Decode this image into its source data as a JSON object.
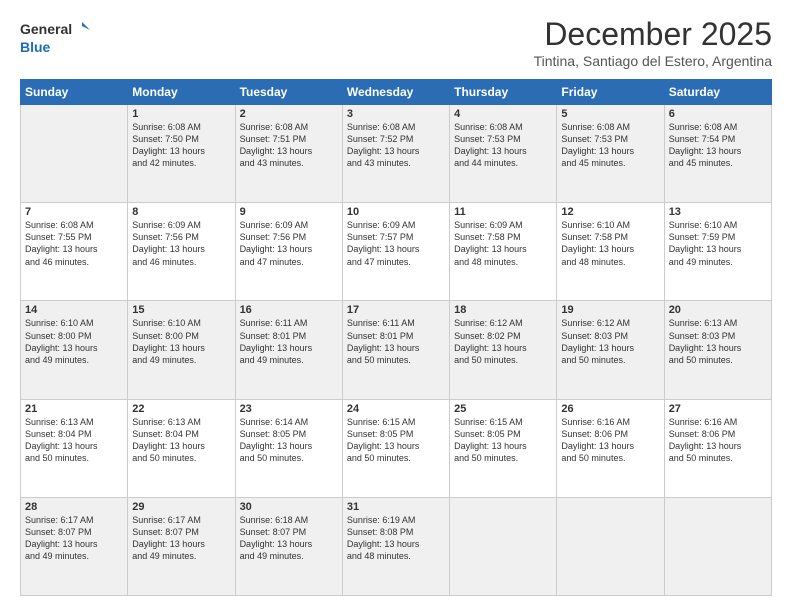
{
  "logo": {
    "general": "General",
    "blue": "Blue"
  },
  "title": "December 2025",
  "subtitle": "Tintina, Santiago del Estero, Argentina",
  "weekdays": [
    "Sunday",
    "Monday",
    "Tuesday",
    "Wednesday",
    "Thursday",
    "Friday",
    "Saturday"
  ],
  "weeks": [
    [
      {
        "day": "",
        "info": ""
      },
      {
        "day": "1",
        "info": "Sunrise: 6:08 AM\nSunset: 7:50 PM\nDaylight: 13 hours\nand 42 minutes."
      },
      {
        "day": "2",
        "info": "Sunrise: 6:08 AM\nSunset: 7:51 PM\nDaylight: 13 hours\nand 43 minutes."
      },
      {
        "day": "3",
        "info": "Sunrise: 6:08 AM\nSunset: 7:52 PM\nDaylight: 13 hours\nand 43 minutes."
      },
      {
        "day": "4",
        "info": "Sunrise: 6:08 AM\nSunset: 7:53 PM\nDaylight: 13 hours\nand 44 minutes."
      },
      {
        "day": "5",
        "info": "Sunrise: 6:08 AM\nSunset: 7:53 PM\nDaylight: 13 hours\nand 45 minutes."
      },
      {
        "day": "6",
        "info": "Sunrise: 6:08 AM\nSunset: 7:54 PM\nDaylight: 13 hours\nand 45 minutes."
      }
    ],
    [
      {
        "day": "7",
        "info": ""
      },
      {
        "day": "8",
        "info": "Sunrise: 6:09 AM\nSunset: 7:56 PM\nDaylight: 13 hours\nand 46 minutes."
      },
      {
        "day": "9",
        "info": "Sunrise: 6:09 AM\nSunset: 7:56 PM\nDaylight: 13 hours\nand 47 minutes."
      },
      {
        "day": "10",
        "info": "Sunrise: 6:09 AM\nSunset: 7:57 PM\nDaylight: 13 hours\nand 47 minutes."
      },
      {
        "day": "11",
        "info": "Sunrise: 6:09 AM\nSunset: 7:58 PM\nDaylight: 13 hours\nand 48 minutes."
      },
      {
        "day": "12",
        "info": "Sunrise: 6:10 AM\nSunset: 7:58 PM\nDaylight: 13 hours\nand 48 minutes."
      },
      {
        "day": "13",
        "info": "Sunrise: 6:10 AM\nSunset: 7:59 PM\nDaylight: 13 hours\nand 49 minutes."
      }
    ],
    [
      {
        "day": "14",
        "info": ""
      },
      {
        "day": "15",
        "info": "Sunrise: 6:10 AM\nSunset: 8:00 PM\nDaylight: 13 hours\nand 49 minutes."
      },
      {
        "day": "16",
        "info": "Sunrise: 6:11 AM\nSunset: 8:01 PM\nDaylight: 13 hours\nand 49 minutes."
      },
      {
        "day": "17",
        "info": "Sunrise: 6:11 AM\nSunset: 8:01 PM\nDaylight: 13 hours\nand 50 minutes."
      },
      {
        "day": "18",
        "info": "Sunrise: 6:12 AM\nSunset: 8:02 PM\nDaylight: 13 hours\nand 50 minutes."
      },
      {
        "day": "19",
        "info": "Sunrise: 6:12 AM\nSunset: 8:03 PM\nDaylight: 13 hours\nand 50 minutes."
      },
      {
        "day": "20",
        "info": "Sunrise: 6:13 AM\nSunset: 8:03 PM\nDaylight: 13 hours\nand 50 minutes."
      }
    ],
    [
      {
        "day": "21",
        "info": ""
      },
      {
        "day": "22",
        "info": "Sunrise: 6:13 AM\nSunset: 8:04 PM\nDaylight: 13 hours\nand 50 minutes."
      },
      {
        "day": "23",
        "info": "Sunrise: 6:14 AM\nSunset: 8:05 PM\nDaylight: 13 hours\nand 50 minutes."
      },
      {
        "day": "24",
        "info": "Sunrise: 6:15 AM\nSunset: 8:05 PM\nDaylight: 13 hours\nand 50 minutes."
      },
      {
        "day": "25",
        "info": "Sunrise: 6:15 AM\nSunset: 8:05 PM\nDaylight: 13 hours\nand 50 minutes."
      },
      {
        "day": "26",
        "info": "Sunrise: 6:16 AM\nSunset: 8:06 PM\nDaylight: 13 hours\nand 50 minutes."
      },
      {
        "day": "27",
        "info": "Sunrise: 6:16 AM\nSunset: 8:06 PM\nDaylight: 13 hours\nand 50 minutes."
      }
    ],
    [
      {
        "day": "28",
        "info": "Sunrise: 6:17 AM\nSunset: 8:07 PM\nDaylight: 13 hours\nand 49 minutes."
      },
      {
        "day": "29",
        "info": "Sunrise: 6:17 AM\nSunset: 8:07 PM\nDaylight: 13 hours\nand 49 minutes."
      },
      {
        "day": "30",
        "info": "Sunrise: 6:18 AM\nSunset: 8:07 PM\nDaylight: 13 hours\nand 49 minutes."
      },
      {
        "day": "31",
        "info": "Sunrise: 6:19 AM\nSunset: 8:08 PM\nDaylight: 13 hours\nand 48 minutes."
      },
      {
        "day": "",
        "info": ""
      },
      {
        "day": "",
        "info": ""
      },
      {
        "day": "",
        "info": ""
      }
    ]
  ],
  "sun_info": {
    "7": "Sunrise: 6:08 AM\nSunset: 7:55 PM\nDaylight: 13 hours\nand 46 minutes.",
    "14": "Sunrise: 6:10 AM\nSunset: 8:00 PM\nDaylight: 13 hours\nand 49 minutes.",
    "21": "Sunrise: 6:13 AM\nSunset: 8:04 PM\nDaylight: 13 hours\nand 50 minutes."
  }
}
